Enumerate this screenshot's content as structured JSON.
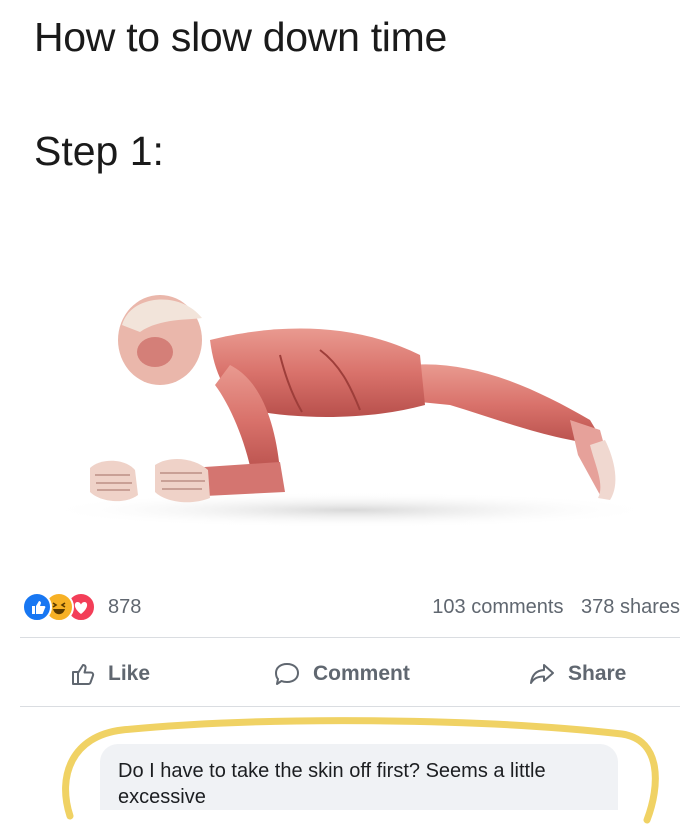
{
  "post": {
    "title": "How to slow down time",
    "step": "Step 1:",
    "image_icon": "anatomical-plank-figure"
  },
  "engagement": {
    "reaction_icons": [
      "like-icon",
      "haha-icon",
      "love-icon"
    ],
    "reaction_count": "878",
    "comments": "103 comments",
    "shares": "378 shares"
  },
  "actions": {
    "like_label": "Like",
    "comment_label": "Comment",
    "share_label": "Share"
  },
  "comment": {
    "text": "Do I have to take the skin off first? Seems a little excessive"
  },
  "colors": {
    "like_blue": "#1877f2",
    "love_red": "#f33e58",
    "haha_yellow": "#f7b125",
    "highlight_yellow": "#f0d264",
    "muscle": "#d9726b"
  }
}
